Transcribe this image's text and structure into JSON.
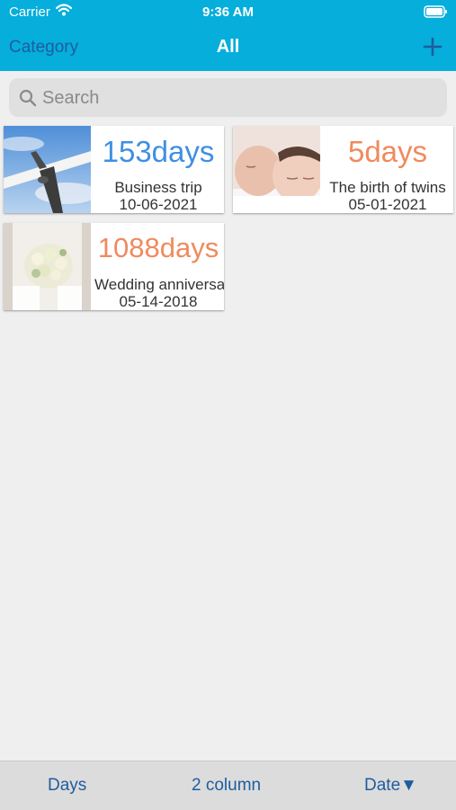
{
  "status": {
    "carrier": "Carrier",
    "time": "9:36 AM"
  },
  "nav": {
    "left_label": "Category",
    "title": "All"
  },
  "search": {
    "placeholder": "Search"
  },
  "colors": {
    "accent": "#05aedb",
    "link": "#1f5c9e",
    "days_blue": "#3f8fe3",
    "days_orange": "#f08a5d"
  },
  "cards": [
    {
      "days": "153days",
      "label": "Business trip",
      "date": "10-06-2021",
      "color": "#3f8fe3",
      "image": "airplane-photo"
    },
    {
      "days": "5days",
      "label": "The birth of twins",
      "date": "05-01-2021",
      "color": "#f08a5d",
      "image": "twins-photo"
    },
    {
      "days": "1088days",
      "label": "Wedding anniversary",
      "date": "05-14-2018",
      "color": "#f08a5d",
      "image": "bouquet-photo"
    }
  ],
  "bottom": {
    "days": "Days",
    "columns": "2 column",
    "sort": "Date▼"
  }
}
